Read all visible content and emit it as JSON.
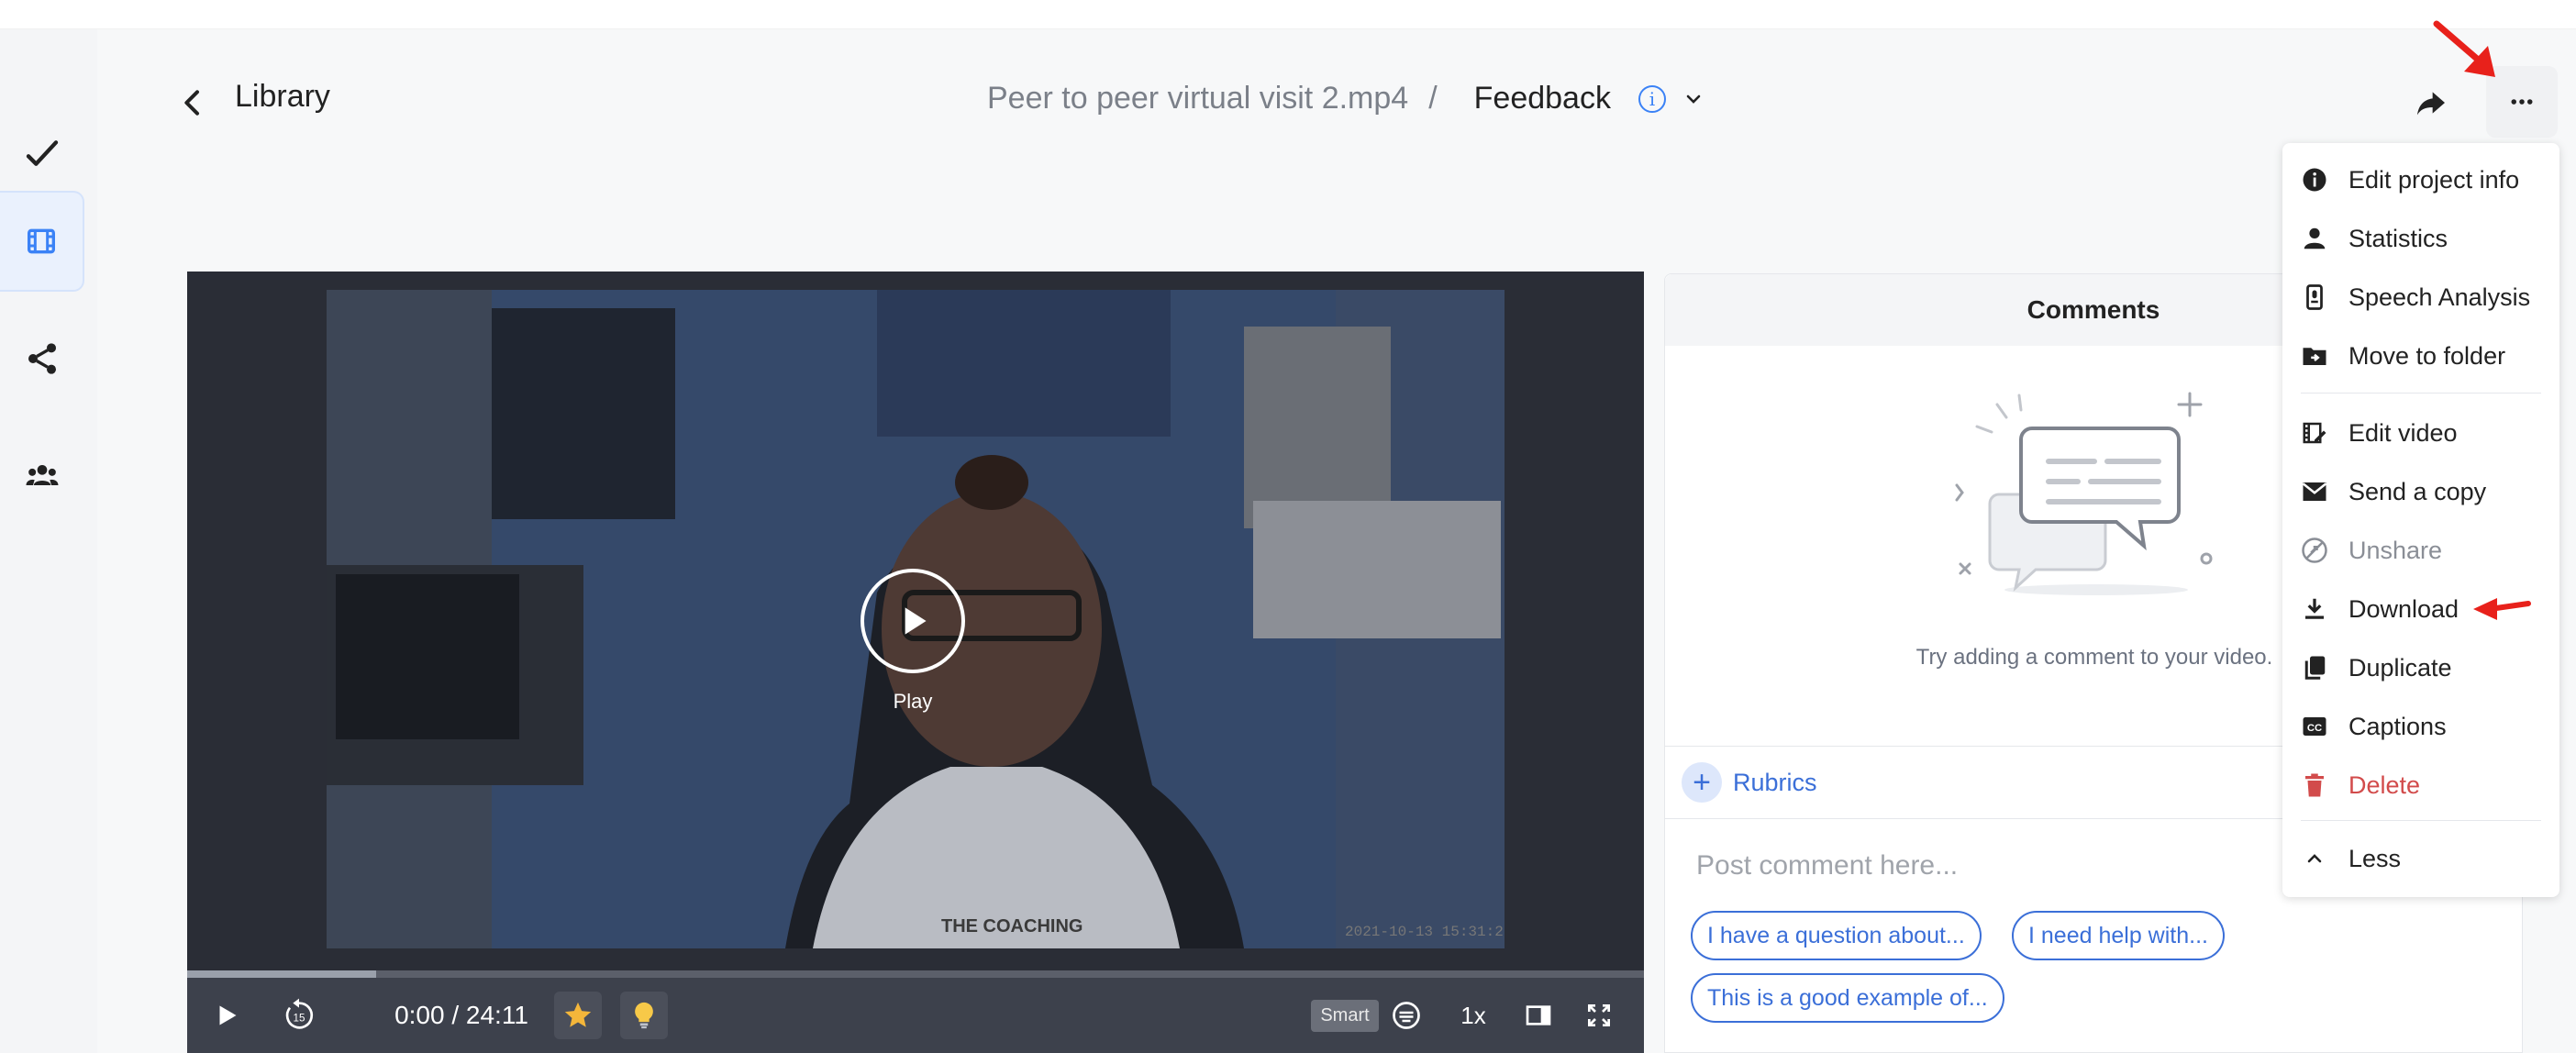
{
  "header": {
    "back_label": "Library",
    "file_name": "Peer to peer virtual visit 2.mp4",
    "separator": "/",
    "view_label": "Feedback"
  },
  "video": {
    "play_label": "Play",
    "time": "0:00 / 24:11",
    "smart_label": "Smart",
    "speed": "1x",
    "skip_back": "15",
    "progress": 0.13
  },
  "comments": {
    "title": "Comments",
    "empty_text": "Try adding a comment to your video.",
    "rubrics_label": "Rubrics",
    "post_placeholder": "Post comment here...",
    "chips": [
      "I have a question about...",
      "I need help with...",
      "This is a good example of..."
    ]
  },
  "menu": {
    "items": [
      {
        "label": "Edit project info",
        "icon": "info-circle-icon"
      },
      {
        "label": "Statistics",
        "icon": "person-icon"
      },
      {
        "label": "Speech Analysis",
        "icon": "speech-analysis-icon"
      },
      {
        "label": "Move to folder",
        "icon": "folder-move-icon"
      },
      {
        "label": "Edit video",
        "icon": "edit-video-icon"
      },
      {
        "label": "Send a copy",
        "icon": "envelope-icon"
      },
      {
        "label": "Unshare",
        "icon": "unshare-icon"
      },
      {
        "label": "Download",
        "icon": "download-icon"
      },
      {
        "label": "Duplicate",
        "icon": "duplicate-icon"
      },
      {
        "label": "Captions",
        "icon": "cc-icon"
      },
      {
        "label": "Delete",
        "icon": "trash-icon"
      },
      {
        "label": "Less",
        "icon": "chevron-up-icon"
      }
    ]
  },
  "colors": {
    "accent": "#3b6fd8",
    "danger": "#d24b4b",
    "annotation_arrow": "#e8211b"
  }
}
